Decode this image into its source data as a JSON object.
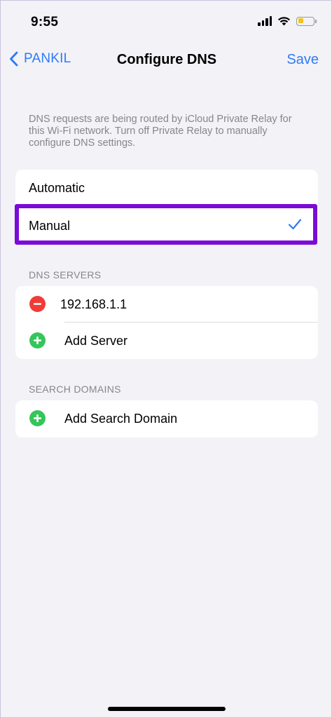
{
  "status_bar": {
    "time": "9:55",
    "icons": [
      "cellular-signal-icon",
      "wifi-icon",
      "battery-icon"
    ],
    "battery_color": "#f4c21b"
  },
  "nav": {
    "back_label": "PANKIL",
    "title": "Configure DNS",
    "save_label": "Save",
    "accent_color": "#2f7bf5"
  },
  "info_text": "DNS requests are being routed by iCloud Private Relay for this Wi-Fi network. Turn off Private Relay to manually configure DNS settings.",
  "dns_mode": {
    "options": [
      {
        "label": "Automatic",
        "selected": false
      },
      {
        "label": "Manual",
        "selected": true
      }
    ],
    "highlight_color": "#7b0bd6"
  },
  "dns_servers": {
    "header": "DNS SERVERS",
    "servers": [
      "192.168.1.1"
    ],
    "add_label": "Add Server"
  },
  "search_domains": {
    "header": "SEARCH DOMAINS",
    "add_label": "Add Search Domain"
  },
  "colors": {
    "remove": "#f03b36",
    "add": "#34c659",
    "background": "#f2f2f7"
  }
}
